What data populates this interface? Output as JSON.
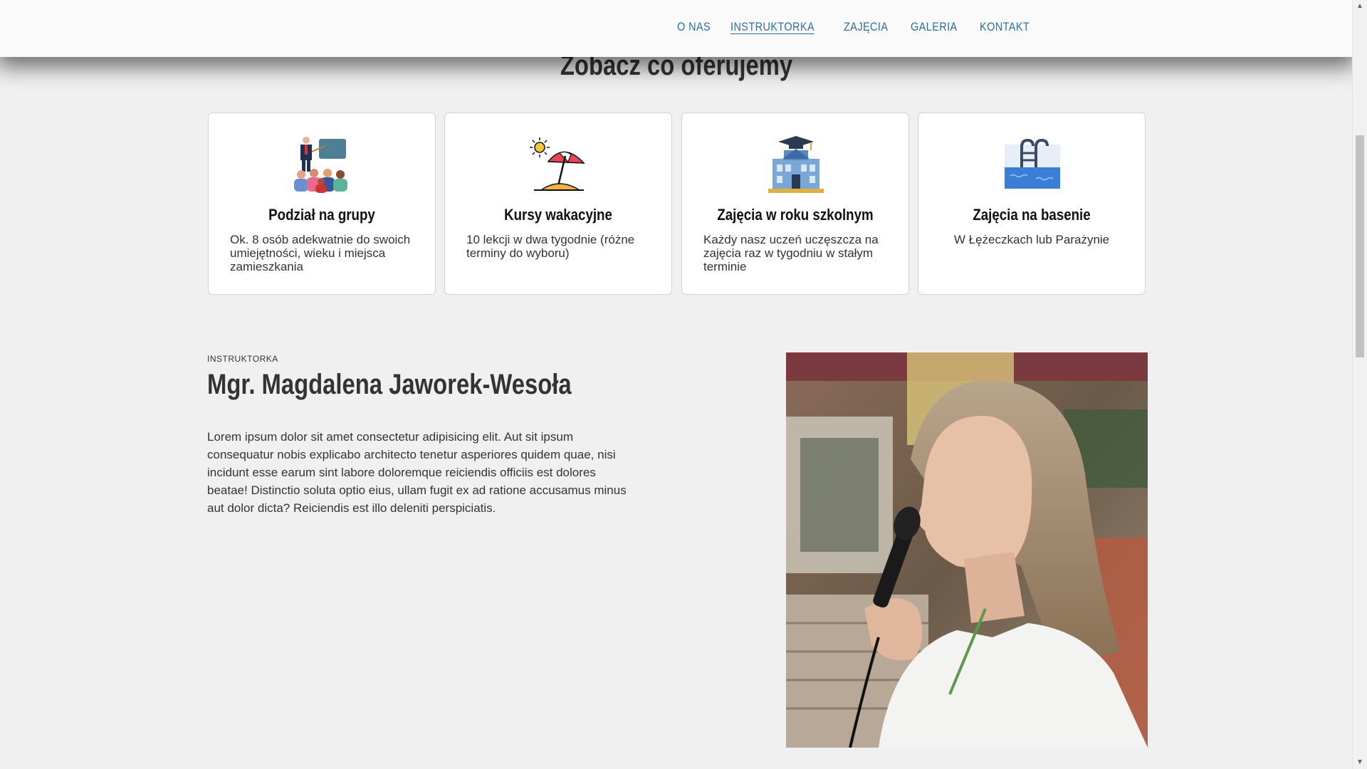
{
  "nav": {
    "items": [
      {
        "label": "O NAS",
        "active": false
      },
      {
        "label": "INSTRUKTORKA",
        "active": true
      },
      {
        "label": "ZAJĘCIA",
        "active": false
      },
      {
        "label": "GALERIA",
        "active": false
      },
      {
        "label": "KONTAKT",
        "active": false
      }
    ]
  },
  "offer": {
    "title": "Zobacz co oferujemy",
    "cards": [
      {
        "icon": "teacher-group-icon",
        "title": "Podział na grupy",
        "description": "Ok. 8 osób adekwatnie do swoich umiejętności, wieku i miejsca zamieszkania"
      },
      {
        "icon": "beach-umbrella-icon",
        "title": "Kursy wakacyjne",
        "description": "10 lekcji w dwa tygodnie (różne terminy do wyboru)"
      },
      {
        "icon": "school-building-icon",
        "title": "Zajęcia w roku szkolnym",
        "description": "Każdy nasz uczeń uczęszcza na zajęcia raz w tygodniu w stałym terminie"
      },
      {
        "icon": "swimming-pool-icon",
        "title": "Zajęcia na basenie",
        "description": "W Łężeczkach lub Parażynie"
      }
    ]
  },
  "instructor": {
    "eyebrow": "INSTRUKTORKA",
    "name": "Mgr. Magdalena Jaworek-Wesoła",
    "bio": "Lorem ipsum dolor sit amet consectetur adipisicing elit. Aut sit ipsum consequatur nobis explicabo architecto tenetur asperiores quidem quae, nisi incidunt esse earum sint labore doloremque reiciendis officiis est dolores beatae! Distinctio soluta optio eius, ullam fugit ex ad ratione accusamus minus aut dolor dicta? Reiciendis est illo deleniti perspiciatis."
  },
  "colors": {
    "nav_link": "#2f6f9a",
    "card_border": "#c9d5e2",
    "page_bg": "#f0f0f0"
  }
}
